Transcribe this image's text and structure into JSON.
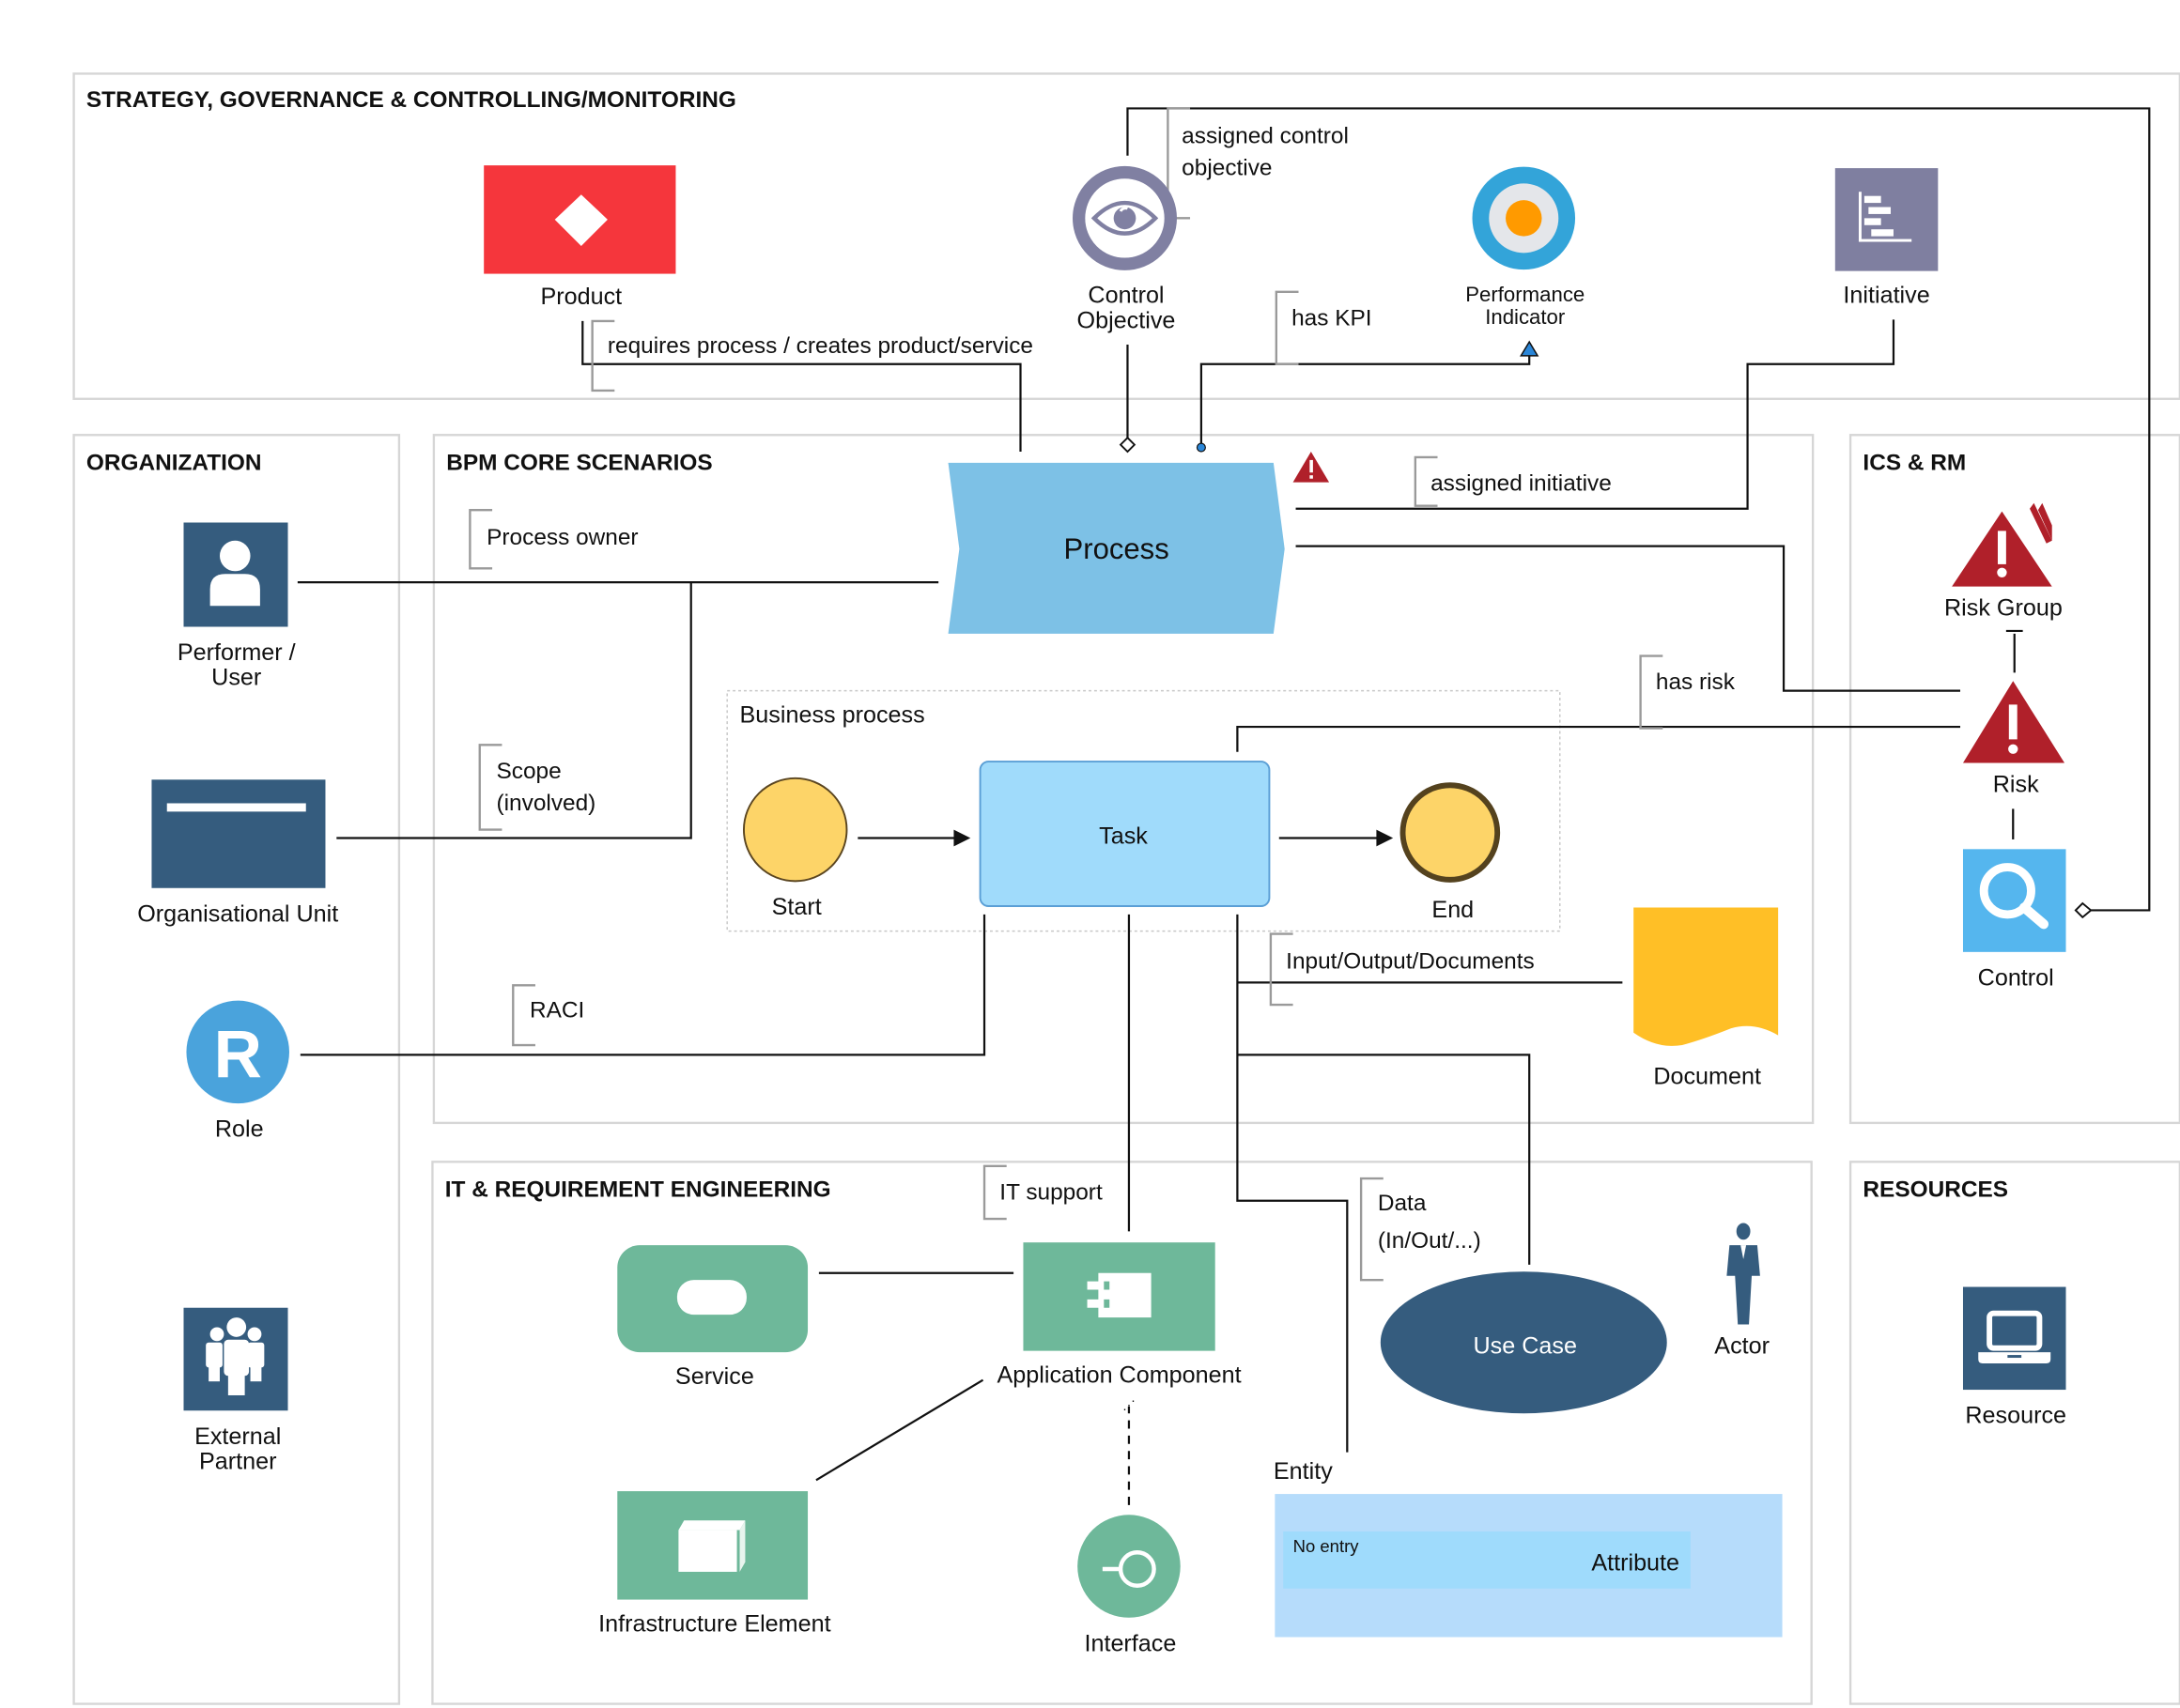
{
  "lanes": {
    "strategy": "STRATEGY, GOVERNANCE & CONTROLLING/MONITORING",
    "organization": "ORGANIZATION",
    "bpm": "BPM CORE SCENARIOS",
    "ics": "ICS & RM",
    "it": "IT & REQUIREMENT ENGINEERING",
    "resources": "RESOURCES"
  },
  "nodes": {
    "product": "Product",
    "control_objective": [
      "Control",
      "Objective"
    ],
    "performance_indicator": [
      "Performance",
      "Indicator"
    ],
    "initiative": "Initiative",
    "process": "Process",
    "performer": [
      "Performer /",
      "User"
    ],
    "org_unit": "Organisational Unit",
    "role": "Role",
    "external_partner": [
      "External",
      "Partner"
    ],
    "business_process": "Business process",
    "start": "Start",
    "task": "Task",
    "end": "End",
    "document": "Document",
    "risk_group": "Risk Group",
    "risk": "Risk",
    "control": "Control",
    "service": "Service",
    "application_component": "Application Component",
    "infrastructure_element": "Infrastructure Element",
    "interface": "Interface",
    "use_case": "Use Case",
    "actor": "Actor",
    "entity": "Entity",
    "attribute_value": "No entry",
    "attribute": "Attribute",
    "resource": "Resource"
  },
  "edges": {
    "assigned_control_objective": [
      "assigned control",
      "objective"
    ],
    "requires_process": "requires process / creates product/service",
    "has_kpi": "has KPI",
    "assigned_initiative": "assigned initiative",
    "process_owner": "Process owner",
    "scope": [
      "Scope",
      "(involved)"
    ],
    "raci": "RACI",
    "has_risk": "has risk",
    "io_documents": "Input/Output/Documents",
    "it_support": "IT support",
    "data": [
      "Data",
      "(In/Out/...)"
    ]
  },
  "colors": {
    "product": "#f5363c",
    "control_objective": "#8080a2",
    "kpi_outer": "#33a4d9",
    "kpi_inner": "#ff9a00",
    "initiative": "#7f7fa0",
    "process": "#7dc1e6",
    "org": "#355c7e",
    "role": "#4aa3dc",
    "task": "#a0dbfb",
    "event": "#fdd468",
    "document": "#ffbf26",
    "risk": "#b0202a",
    "control": "#55b6ee",
    "it_green": "#6eb89a",
    "entity": "#b6dcfb",
    "attribute": "#9fdbfc"
  }
}
